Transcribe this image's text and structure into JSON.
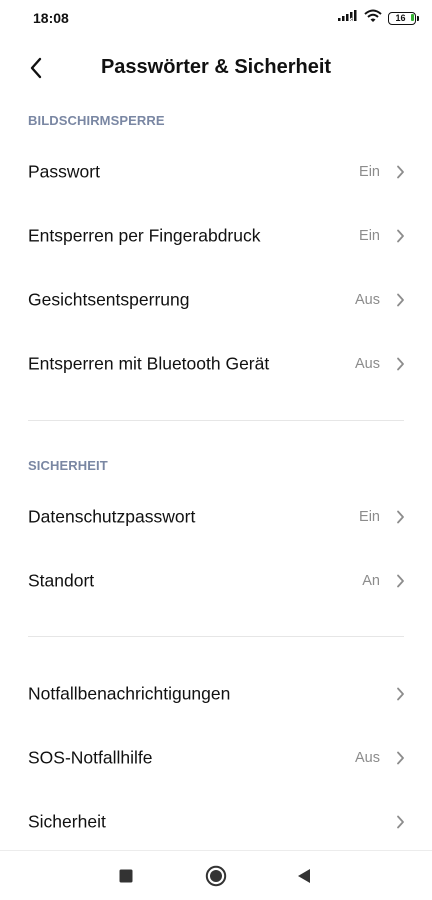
{
  "status_bar": {
    "time": "18:08",
    "battery_level": "16",
    "icons": [
      "signal-icon",
      "wifi-icon",
      "battery-icon"
    ]
  },
  "header": {
    "title": "Passwörter & Sicherheit",
    "back_icon": "chevron-left-icon"
  },
  "sections": [
    {
      "title": "BILDSCHIRMSPERRE",
      "items": [
        {
          "label": "Passwort",
          "value": "Ein"
        },
        {
          "label": "Entsperren per Fingerabdruck",
          "value": "Ein"
        },
        {
          "label": "Gesichtsentsperrung",
          "value": "Aus"
        },
        {
          "label": "Entsperren mit Bluetooth Gerät",
          "value": "Aus"
        }
      ]
    },
    {
      "title": "SICHERHEIT",
      "items": [
        {
          "label": "Datenschutzpasswort",
          "value": "Ein"
        },
        {
          "label": "Standort",
          "value": "An"
        }
      ]
    },
    {
      "title": "",
      "items": [
        {
          "label": "Notfallbenachrichtigungen",
          "value": ""
        },
        {
          "label": "SOS-Notfallhilfe",
          "value": "Aus"
        },
        {
          "label": "Sicherheit",
          "value": ""
        }
      ]
    }
  ],
  "nav_bar": {
    "buttons": [
      "recents-square-icon",
      "home-circle-icon",
      "back-triangle-icon"
    ]
  },
  "colors": {
    "section_header": "#7a87a3",
    "value_text": "#8c8c8c",
    "battery_fill": "#34b233"
  }
}
